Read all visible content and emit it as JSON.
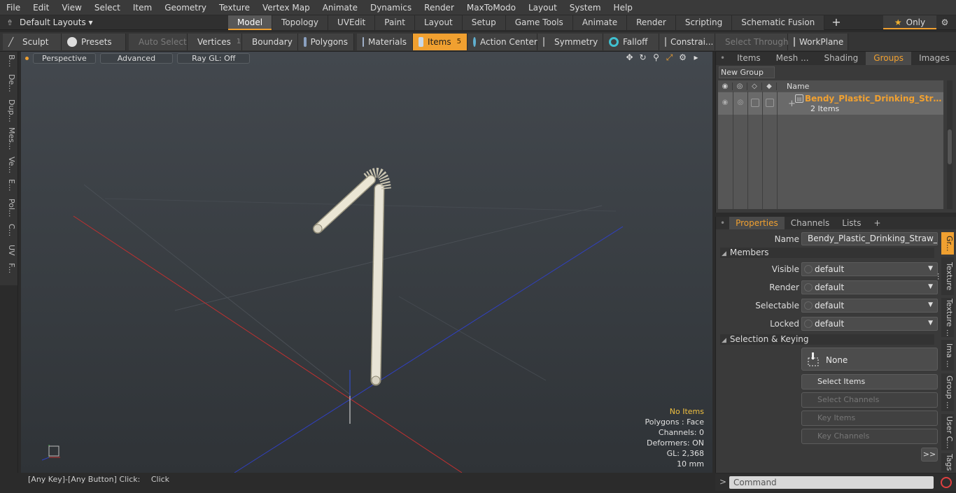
{
  "menu": [
    "File",
    "Edit",
    "View",
    "Select",
    "Item",
    "Geometry",
    "Texture",
    "Vertex Map",
    "Animate",
    "Dynamics",
    "Render",
    "MaxToModo",
    "Layout",
    "System",
    "Help"
  ],
  "layout_dropdown": "Default Layouts ▾",
  "layout_tabs": [
    "Model",
    "Topology",
    "UVEdit",
    "Paint",
    "Layout",
    "Setup",
    "Game Tools",
    "Animate",
    "Render",
    "Scripting",
    "Schematic Fusion"
  ],
  "active_layout_tab": "Model",
  "only_label": "Only",
  "toolbar": {
    "sculpt": "Sculpt",
    "presets": "Presets",
    "auto_select": "Auto Select",
    "vertices": "Vertices",
    "vertices_count": "1",
    "boundary": "Boundary",
    "polygons": "Polygons",
    "materials": "Materials",
    "items": "Items",
    "items_count": "5",
    "action_center": "Action Center",
    "symmetry": "Symmetry",
    "falloff": "Falloff",
    "constraints": "Constrai...",
    "select_through": "Select Through",
    "workplane": "WorkPlane"
  },
  "left_tools": [
    "B...",
    "De...",
    "Dup...",
    "Mes...",
    "Ve...",
    "E...",
    "Pol...",
    "C...",
    "UV",
    "F..."
  ],
  "viewport": {
    "view": "Perspective",
    "mode": "Advanced",
    "raygl": "Ray GL: Off",
    "hud": {
      "items": "No Items",
      "polygons": "Polygons : Face",
      "channels": "Channels: 0",
      "deformers": "Deformers: ON",
      "gl": "GL: 2,368",
      "scale": "10 mm"
    }
  },
  "status": {
    "hint": "[Any Key]-[Any Button] Click:",
    "action": "Click"
  },
  "groups_panel": {
    "tabs": [
      "Items",
      "Mesh ...",
      "Shading",
      "Groups",
      "Images"
    ],
    "active_tab": "Groups",
    "new_group": "New Group",
    "column_name": "Name",
    "group_name": "Bendy_Plastic_Drinking_Straw_...",
    "group_items": "2 Items"
  },
  "properties_panel": {
    "tabs": [
      "Properties",
      "Channels",
      "Lists"
    ],
    "active_tab": "Properties",
    "name_label": "Name",
    "name_value": "Bendy_Plastic_Drinking_Straw_Striped",
    "members_section": "Members",
    "visible_label": "Visible",
    "visible_value": "default",
    "render_label": "Render",
    "render_value": "default",
    "selectable_label": "Selectable",
    "selectable_value": "default",
    "locked_label": "Locked",
    "locked_value": "default",
    "selection_section": "Selection & Keying",
    "none_label": "None",
    "select_items": "Select Items",
    "select_channels": "Select Channels",
    "key_items": "Key Items",
    "key_channels": "Key Channels",
    "more": ">>",
    "side_tabs": [
      "Gr...",
      "Texture ...",
      "Texture ...",
      "Ima ...",
      "Group ...",
      "User C...",
      "Tags"
    ]
  },
  "command": {
    "prompt": ">",
    "placeholder": "Command"
  },
  "colors": {
    "accent": "#f0a030",
    "x_axis": "#c03030",
    "z_axis": "#3040c0",
    "record": "#e04040"
  }
}
